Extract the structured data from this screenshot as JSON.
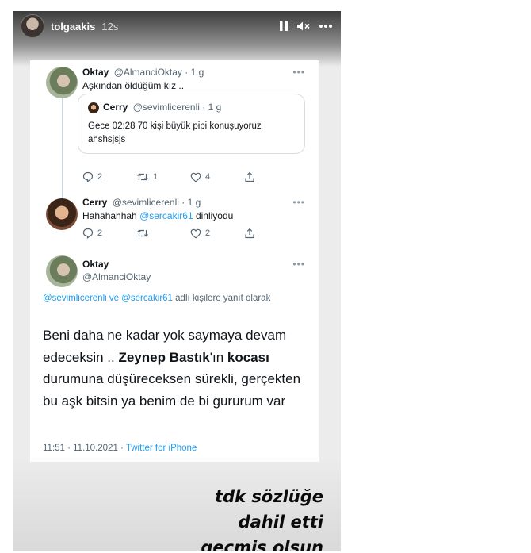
{
  "story": {
    "username": "tolgaakis",
    "time_ago": "12s",
    "icons": [
      "pause-icon",
      "mute-icon",
      "more-icon"
    ]
  },
  "tweets": [
    {
      "name": "Oktay",
      "handle": "@AlmanciOktay",
      "time": "· 1 g",
      "text": "Aşkından öldüğüm kız ..",
      "quote": {
        "name": "Cerry",
        "handle": "@sevimlicerenli",
        "time": "· 1 g",
        "text": "Gece 02:28 70 kişi büyük pipi konuşuyoruz ahshsjsjs"
      },
      "replies": "2",
      "retweets": "1",
      "likes": "4"
    },
    {
      "name": "Cerry",
      "handle": "@sevimlicerenli",
      "time": "· 1 g",
      "text_before": "Hahahahhah ",
      "mention": "@sercakir61",
      "text_after": " dinliyodu",
      "replies": "2",
      "retweets": "",
      "likes": "2"
    }
  ],
  "main_tweet": {
    "name": "Oktay",
    "handle": "@AlmanciOktay",
    "reply_mentions": "@sevimlicerenli ve @sercakir61",
    "reply_suffix": " adlı kişilere yanıt olarak",
    "text_1": "Beni daha ne kadar yok saymaya devam edeceksin .. ",
    "bold_1": "Zeynep Bastık",
    "text_2": "'ın ",
    "bold_2": "kocası",
    "text_3": " durumuna düşüreceksen sürekli, gerçekten bu aşk bitsin ya benim de bi gururum var",
    "timestamp": "11:51 · 11.10.2021 · ",
    "source": "Twitter for iPhone"
  },
  "caption": {
    "line1": "tdk sözlüğe",
    "line2": "dahil etti",
    "line3": "geçmiş olsun"
  },
  "colors": {
    "link": "#1d9bf0",
    "text": "#0f1419",
    "secondary": "#536471"
  }
}
